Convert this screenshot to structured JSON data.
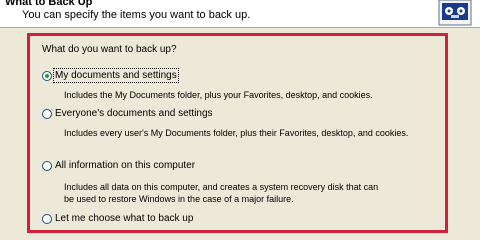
{
  "header": {
    "title": "What to Back Up",
    "subtitle": "You can specify the items you want to back up."
  },
  "question": "What do you want to back up?",
  "options": [
    {
      "label": "My documents and settings",
      "description": "Includes the My Documents folder, plus your Favorites, desktop, and cookies.",
      "selected": true
    },
    {
      "label": "Everyone's documents and settings",
      "description": "Includes every user's My Documents folder, plus their Favorites, desktop, and cookies.",
      "selected": false
    },
    {
      "label": "All information on this computer",
      "description_line1": "Includes all data on this computer, and creates a system recovery disk that can",
      "description_line2": "be used to restore Windows in the case of a major failure.",
      "selected": false
    },
    {
      "label": "Let me choose what to back up",
      "selected": false
    }
  ],
  "colors": {
    "highlight_frame": "#d21f3c",
    "dialog_background": "#ece9d8",
    "radio_dot": "#21a121"
  },
  "icons": {
    "header_icon": "backup-tape-icon"
  }
}
